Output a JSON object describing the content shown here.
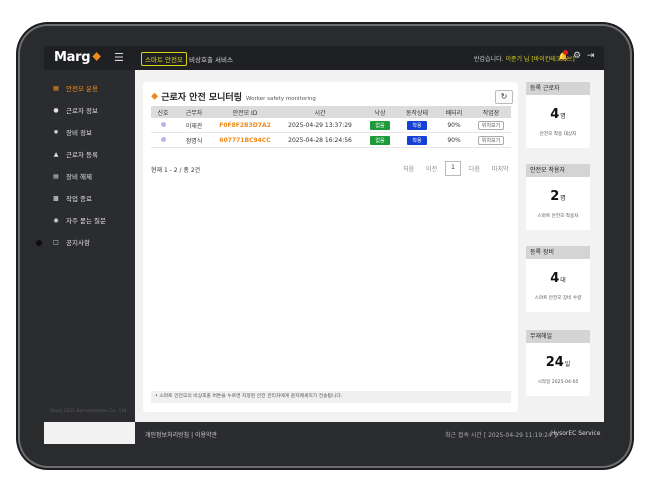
{
  "header": {
    "logo": "Marg",
    "tag_smart": "스마트 안전모",
    "tag_call": "비상호출 서비스",
    "greeting": "반갑습니다.",
    "user_name": "이준기 님 [바이킨테크티브]"
  },
  "sidebar": {
    "items": [
      {
        "label": "안전모 운용",
        "icon": "grid-icon",
        "active": true
      },
      {
        "label": "근로자 정보",
        "icon": "user-icon"
      },
      {
        "label": "장비 정보",
        "icon": "settings-icon"
      },
      {
        "label": "근로자 등록",
        "icon": "triangle-icon"
      },
      {
        "label": "장비 해제",
        "icon": "card-icon"
      },
      {
        "label": "작업 종료",
        "icon": "clipboard-icon"
      },
      {
        "label": "자주 묻는 질문",
        "icon": "chat-icon"
      },
      {
        "label": "공지사항",
        "icon": "square-icon"
      }
    ],
    "copyright": "Since 2025 Bernetweston Co., Ltd."
  },
  "panel": {
    "title": "근로자 안전 모니터링",
    "subtitle": "Worker safety monitoring",
    "columns": [
      "신호",
      "근무자",
      "안전모 ID",
      "시간",
      "낙상",
      "동작상태",
      "배터리",
      "작업장"
    ],
    "rows": [
      {
        "name": "이재관",
        "helmet_id": "F0F8F2B3D7A2",
        "time": "2025-04-29 13:37:29",
        "fall": "없음",
        "status": "착용",
        "battery": "90%",
        "site": "위치보기"
      },
      {
        "name": "정명식",
        "helmet_id": "607771BC94CC",
        "time": "2025-04-28 16:24:56",
        "fall": "없음",
        "status": "착용",
        "battery": "90%",
        "site": "위치보기"
      }
    ],
    "total": "현재 1 - 2 / 총 2건",
    "pager": {
      "first": "처음",
      "prev": "이전",
      "page": "1",
      "next": "다음",
      "last": "마지막"
    },
    "notice": "• 스마트 안전모의 비상호출 버튼을 누르면 지정된 안전 관리자에게 문자메세지가 전송됩니다."
  },
  "cards": [
    {
      "title": "등록 근로자",
      "value": "4",
      "unit": "명",
      "desc": "안전모 착용 대상자"
    },
    {
      "title": "안전모 착용자",
      "value": "2",
      "unit": "명",
      "desc": "스마트 안전모 착용자"
    },
    {
      "title": "등록 장비",
      "value": "4",
      "unit": "대",
      "desc": "스마트 안전모 장비 수량"
    },
    {
      "title": "무재해일",
      "value": "24",
      "unit": "일",
      "desc": "시작일 2025-04-05"
    }
  ],
  "footer": {
    "links": "개인정보처리방침 | 이용약관",
    "updated": "최근 접속 시간 [ 2025-04-29 11:19:24 ]",
    "service": "HysorEC Service"
  },
  "colors": {
    "accent": "#f08a1c",
    "highlight": "#d8d51d",
    "status_normal": "#1f9a3a",
    "status_work": "#1540d6"
  }
}
